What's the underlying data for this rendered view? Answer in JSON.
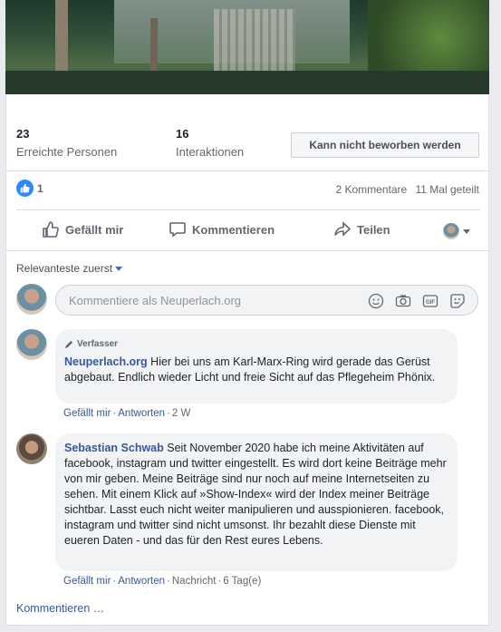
{
  "stats": {
    "reach_count": "23",
    "reach_label": "Erreichte Personen",
    "interactions_count": "16",
    "interactions_label": "Interaktionen",
    "promote_button": "Kann nicht beworben werden"
  },
  "reactions": {
    "like_count": "1",
    "comments": "2 Kommentare",
    "shares": "11 Mal geteilt"
  },
  "actions": {
    "like": "Gefällt mir",
    "comment": "Kommentieren",
    "share": "Teilen"
  },
  "sort_label": "Relevanteste zuerst",
  "composer": {
    "placeholder": "Kommentiere als Neuperlach.org",
    "icons": [
      "emoji-icon",
      "camera-icon",
      "gif-icon",
      "sticker-icon"
    ]
  },
  "comments": [
    {
      "badge": "Verfasser",
      "author": "Neuperlach.org",
      "text": "Hier bei uns am Karl-Marx-Ring wird gerade das Gerüst abgebaut. Endlich wieder Licht und freie Sicht auf das Pflegeheim Phönix.",
      "like_link": "Gefällt mir",
      "reply_link": "Antworten",
      "time": "2 W"
    },
    {
      "author": "Sebastian Schwab",
      "text": "Seit November 2020 habe ich meine Aktivitäten auf facebook, instagram und twitter eingestellt. Es wird dort keine Beiträge mehr von mir geben. Meine Beiträge sind nur noch auf meine Internetseiten zu sehen. Mit einem Klick auf »Show-Index« wird der Index meiner Beiträge sichtbar. Lasst euch nicht weiter manipulieren und ausspionieren. facebook, instagram und twitter sind nicht umsonst. Ihr bezahlt diese Dienste mit eueren Daten - und das für den Rest eures Lebens.",
      "like_link": "Gefällt mir",
      "reply_link": "Antworten",
      "message_link": "Nachricht",
      "time": "6 Tag(e)"
    }
  ],
  "more_comments": "Kommentieren …",
  "colors": {
    "link": "#385898",
    "like_blue": "#2e89ff",
    "bubble": "#f2f3f5"
  }
}
